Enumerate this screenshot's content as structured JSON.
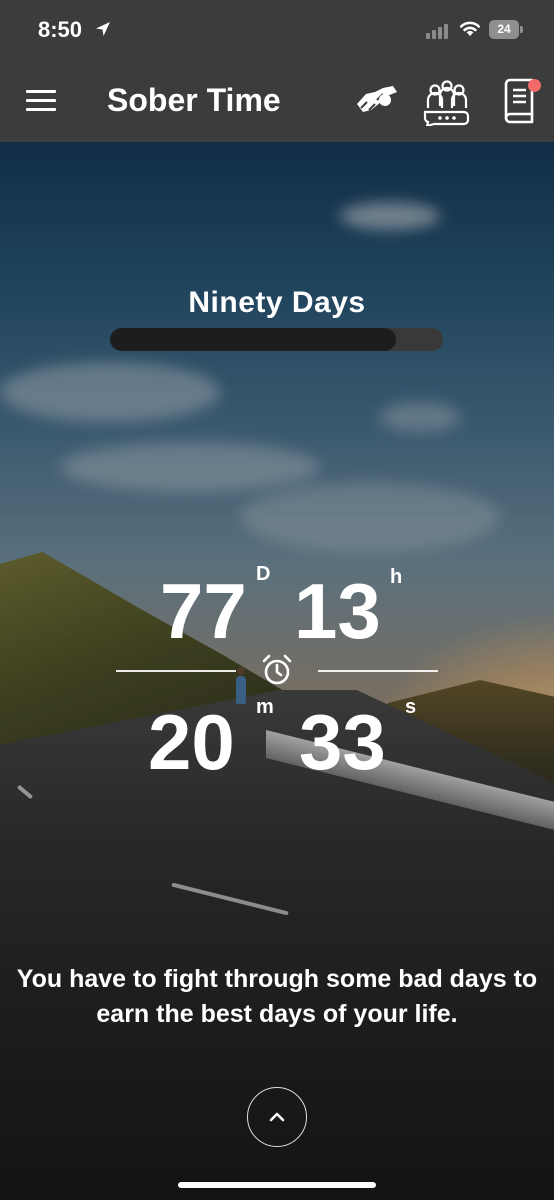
{
  "status_bar": {
    "time": "8:50",
    "battery": "24"
  },
  "app_bar": {
    "title": "Sober Time",
    "icons": [
      "menu-icon",
      "handshake-icon",
      "community-icon",
      "journal-icon"
    ],
    "notification_dot_color": "#f26a6a"
  },
  "milestone": {
    "label": "Ninety Days",
    "progress": 0.86
  },
  "counter": {
    "days": "77",
    "days_unit": "D",
    "hours": "13",
    "hours_unit": "h",
    "minutes": "20",
    "minutes_unit": "m",
    "seconds": "33",
    "seconds_unit": "s"
  },
  "quote": "You have to fight through some bad days to earn the best days of your life.",
  "colors": {
    "bar_background": "#3c3c3c",
    "progress_track": "#393939",
    "progress_fill": "#1d1d1d",
    "text": "#ffffff"
  }
}
